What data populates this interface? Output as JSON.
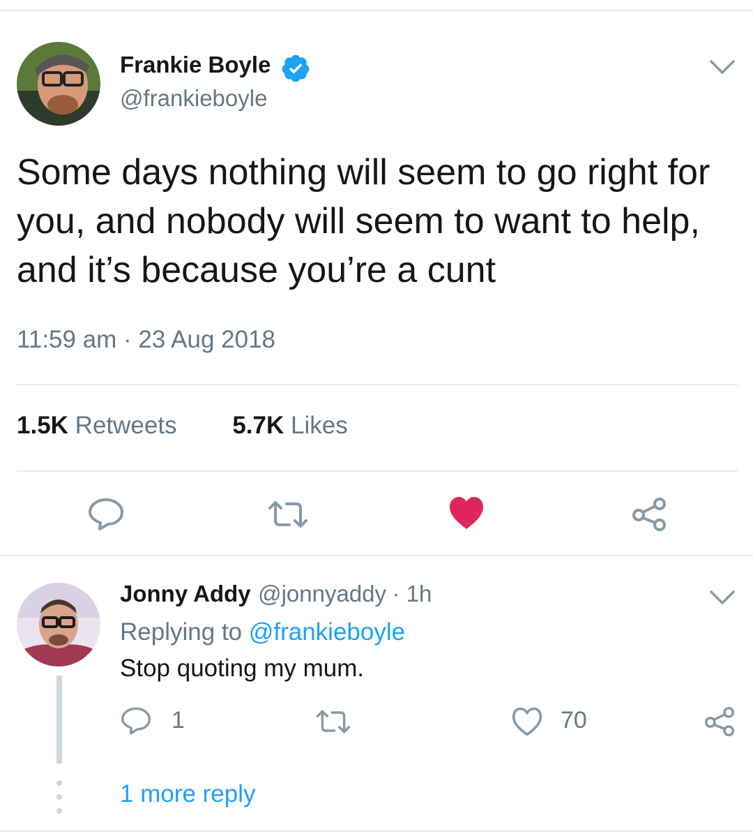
{
  "tweet": {
    "author_name": "Frankie Boyle",
    "author_handle": "@frankieboyle",
    "text": "Some days nothing will seem to go right for you, and nobody will seem to want to help, and it’s because you’re a cunt",
    "timestamp": "11:59 am · 23 Aug 2018",
    "retweets_count": "1.5K",
    "retweets_label": "Retweets",
    "likes_count": "5.7K",
    "likes_label": "Likes",
    "liked": true,
    "verified": true
  },
  "reply": {
    "author_name": "Jonny Addy",
    "author_handle": "@jonnyaddy",
    "time_ago": "· 1h",
    "replying_prefix": "Replying to",
    "replying_to": "@frankieboyle",
    "text": "Stop quoting my mum.",
    "reply_count": "1",
    "like_count": "70"
  },
  "more_replies_label": "1 more reply",
  "icons": {
    "chevron": "chevron-down-icon",
    "reply": "reply-icon",
    "retweet": "retweet-icon",
    "like": "heart-icon",
    "share": "share-icon",
    "verified": "verified-badge-icon"
  },
  "colors": {
    "accent": "#1da1f2",
    "like": "#e0245e",
    "muted": "#657786",
    "divider": "#e6ecf0",
    "thread_line": "#ccd6dd"
  }
}
